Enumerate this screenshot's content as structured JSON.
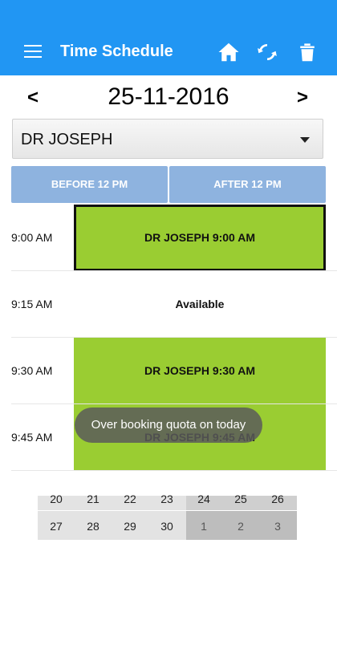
{
  "appbar": {
    "title": "Time Schedule",
    "icons": [
      "menu-icon",
      "home-icon",
      "refresh-icon",
      "trash-icon"
    ],
    "color": "#2196f3"
  },
  "date_nav": {
    "prev": "<",
    "date": "25-11-2016",
    "next": ">"
  },
  "doctor_select": {
    "value": "DR JOSEPH"
  },
  "tabs": [
    "BEFORE 12 PM",
    "AFTER 12 PM"
  ],
  "slots": [
    {
      "time": "9:00 AM",
      "label": "DR JOSEPH 9:00 AM",
      "booked": true,
      "selected": true
    },
    {
      "time": "9:15 AM",
      "label": "Available",
      "booked": false,
      "selected": false
    },
    {
      "time": "9:30 AM",
      "label": "DR JOSEPH 9:30 AM",
      "booked": true,
      "selected": false
    },
    {
      "time": "9:45 AM",
      "label": "DR JOSEPH 9:45 AM",
      "booked": true,
      "selected": false
    }
  ],
  "toast": "Over booking quota on today",
  "calendar": {
    "row1": [
      "20",
      "21",
      "22",
      "23",
      "24",
      "25",
      "26"
    ],
    "row2": [
      "27",
      "28",
      "29",
      "30",
      "1",
      "2",
      "3"
    ]
  },
  "colors": {
    "booked": "#9acd32",
    "tab": "#8eb3df"
  }
}
